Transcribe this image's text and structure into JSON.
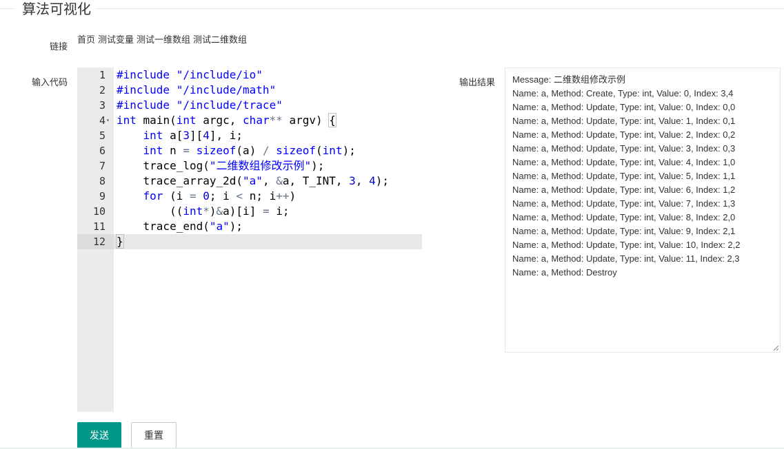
{
  "section_title": "算法可视化",
  "links_label": "链接",
  "links": [
    "首页",
    "测试变量",
    "测试一维数组",
    "测试二维数组"
  ],
  "code_label": "输入代码",
  "output_label": "输出结果",
  "code_lines": [
    "#include \"/include/io\"",
    "#include \"/include/math\"",
    "#include \"/include/trace\"",
    "int main(int argc, char** argv) {",
    "    int a[3][4], i;",
    "    int n = sizeof(a) / sizeof(int);",
    "    trace_log(\"二维数组修改示例\");",
    "    trace_array_2d(\"a\", &a, T_INT, 3, 4);",
    "    for (i = 0; i < n; i++)",
    "        ((int*)&a)[i] = i;",
    "    trace_end(\"a\");",
    "}"
  ],
  "line_numbers": [
    "1",
    "2",
    "3",
    "4",
    "5",
    "6",
    "7",
    "8",
    "9",
    "10",
    "11",
    "12"
  ],
  "active_line": 12,
  "output_lines": [
    "Message: 二维数组修改示例",
    "Name: a,  Method: Create, Type: int, Value: 0, Index: 3,4",
    "Name: a,  Method: Update, Type: int, Value: 0, Index: 0,0",
    "Name: a,  Method: Update, Type: int, Value: 1, Index: 0,1",
    "Name: a,  Method: Update, Type: int, Value: 2, Index: 0,2",
    "Name: a,  Method: Update, Type: int, Value: 3, Index: 0,3",
    "Name: a,  Method: Update, Type: int, Value: 4, Index: 1,0",
    "Name: a,  Method: Update, Type: int, Value: 5, Index: 1,1",
    "Name: a,  Method: Update, Type: int, Value: 6, Index: 1,2",
    "Name: a,  Method: Update, Type: int, Value: 7, Index: 1,3",
    "Name: a,  Method: Update, Type: int, Value: 8, Index: 2,0",
    "Name: a,  Method: Update, Type: int, Value: 9, Index: 2,1",
    "Name: a,  Method: Update, Type: int, Value: 10, Index: 2,2",
    "Name: a,  Method: Update, Type: int, Value: 11, Index: 2,3",
    "Name: a,  Method: Destroy"
  ],
  "buttons": {
    "send": "发送",
    "reset": "重置"
  },
  "colors": {
    "primary": "#009688",
    "keyword": "#0000ff",
    "gutter": "#ebebeb"
  }
}
